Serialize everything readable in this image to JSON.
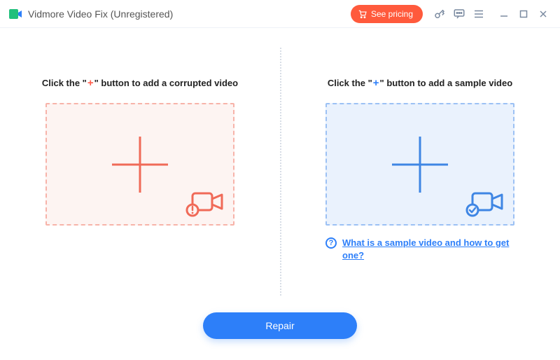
{
  "titlebar": {
    "app_title": "Vidmore Video Fix (Unregistered)",
    "see_pricing_label": "See pricing"
  },
  "panels": {
    "left": {
      "caption_prefix": "Click the \"",
      "caption_suffix": "\" button to add a corrupted video"
    },
    "right": {
      "caption_prefix": "Click the \"",
      "caption_suffix": "\" button to add a sample video",
      "help_text": "What is a sample video and how to get one?",
      "help_symbol": "?"
    }
  },
  "footer": {
    "repair_label": "Repair"
  },
  "colors": {
    "accent_blue": "#2d7ff9",
    "accent_red": "#f06a58",
    "pricing_bg": "#ff5a3c"
  }
}
